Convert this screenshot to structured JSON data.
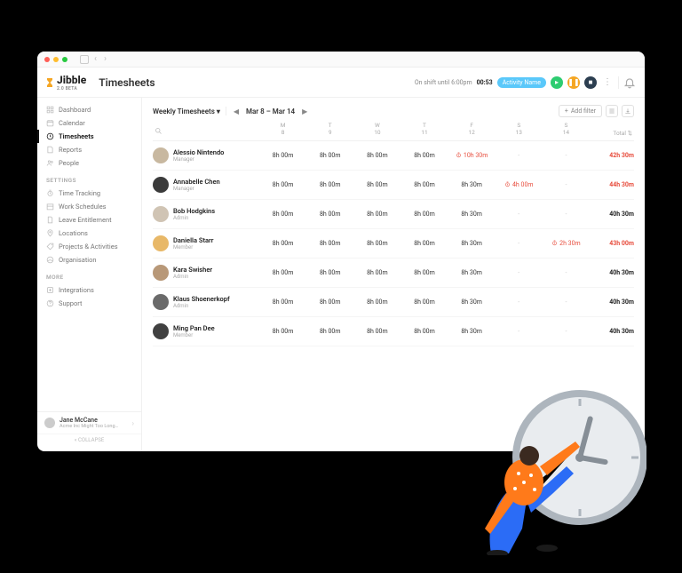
{
  "brand": {
    "name": "Jibble",
    "tagline": "2.0 BETA",
    "accent": "#f5a623"
  },
  "page": {
    "title": "Timesheets"
  },
  "shift": {
    "label": "On shift until 6:00pm",
    "elapsed": "00:53",
    "activity": "Activity Name"
  },
  "sidebar": {
    "items": [
      {
        "icon": "dashboard-icon",
        "label": "Dashboard"
      },
      {
        "icon": "calendar-icon",
        "label": "Calendar"
      },
      {
        "icon": "timesheets-icon",
        "label": "Timesheets",
        "active": true
      },
      {
        "icon": "reports-icon",
        "label": "Reports"
      },
      {
        "icon": "people-icon",
        "label": "People"
      }
    ],
    "settings_label": "SETTINGS",
    "settings": [
      {
        "icon": "clock-icon",
        "label": "Time Tracking"
      },
      {
        "icon": "schedule-icon",
        "label": "Work Schedules"
      },
      {
        "icon": "leave-icon",
        "label": "Leave Entitlement"
      },
      {
        "icon": "location-icon",
        "label": "Locations"
      },
      {
        "icon": "tag-icon",
        "label": "Projects & Activities"
      },
      {
        "icon": "org-icon",
        "label": "Organisation"
      }
    ],
    "more_label": "MORE",
    "more": [
      {
        "icon": "integrations-icon",
        "label": "Integrations"
      },
      {
        "icon": "support-icon",
        "label": "Support"
      }
    ],
    "user": {
      "name": "Jane McCane",
      "org": "Acme Inc Might Too Long…"
    },
    "collapse": "COLLAPSE"
  },
  "toolbar": {
    "view": "Weekly Timesheets",
    "range": "Mar 8 – Mar 14",
    "add_filter": "Add filter"
  },
  "columns": [
    {
      "dow": "M",
      "num": "8"
    },
    {
      "dow": "T",
      "num": "9"
    },
    {
      "dow": "W",
      "num": "10"
    },
    {
      "dow": "T",
      "num": "11"
    },
    {
      "dow": "F",
      "num": "12"
    },
    {
      "dow": "S",
      "num": "13"
    },
    {
      "dow": "S",
      "num": "14"
    }
  ],
  "total_header": "Total",
  "rows": [
    {
      "name": "Alessio Nintendo",
      "role": "Manager",
      "avatar": "#c8b8a0",
      "cells": [
        "8h 00m",
        "8h 00m",
        "8h 00m",
        "8h 00m",
        {
          "v": "10h 30m",
          "over": true
        },
        "-",
        "-"
      ],
      "total": {
        "v": "42h 30m",
        "over": true
      }
    },
    {
      "name": "Annabelle Chen",
      "role": "Manager",
      "avatar": "#3b3b3b",
      "cells": [
        "8h 00m",
        "8h 00m",
        "8h 00m",
        "8h 00m",
        "8h 30m",
        {
          "v": "4h 00m",
          "over": true
        },
        "-"
      ],
      "total": {
        "v": "44h 30m",
        "over": true
      }
    },
    {
      "name": "Bob Hodgkins",
      "role": "Admin",
      "avatar": "#d0c4b4",
      "cells": [
        "8h 00m",
        "8h 00m",
        "8h 00m",
        "8h 00m",
        "8h 30m",
        "-",
        "-"
      ],
      "total": {
        "v": "40h 30m"
      }
    },
    {
      "name": "Daniella Starr",
      "role": "Member",
      "avatar": "#e8b868",
      "cells": [
        "8h 00m",
        "8h 00m",
        "8h 00m",
        "8h 00m",
        "8h 30m",
        "-",
        {
          "v": "2h 30m",
          "over": true
        }
      ],
      "total": {
        "v": "43h 00m",
        "over": true
      }
    },
    {
      "name": "Kara Swisher",
      "role": "Admin",
      "avatar": "#b89878",
      "cells": [
        "8h 00m",
        "8h 00m",
        "8h 00m",
        "8h 00m",
        "8h 30m",
        "-",
        "-"
      ],
      "total": {
        "v": "40h 30m"
      }
    },
    {
      "name": "Klaus Shoenerkopf",
      "role": "Admin",
      "avatar": "#6a6a6a",
      "cells": [
        "8h 00m",
        "8h 00m",
        "8h 00m",
        "8h 00m",
        "8h 30m",
        "-",
        "-"
      ],
      "total": {
        "v": "40h 30m"
      }
    },
    {
      "name": "Ming Pan Dee",
      "role": "Member",
      "avatar": "#404040",
      "cells": [
        "8h 00m",
        "8h 00m",
        "8h 00m",
        "8h 00m",
        "8h 30m",
        "-",
        "-"
      ],
      "total": {
        "v": "40h 30m"
      }
    }
  ]
}
